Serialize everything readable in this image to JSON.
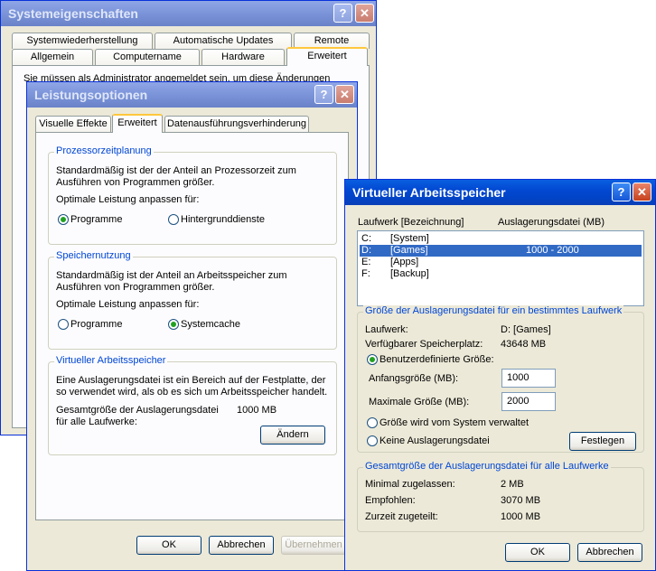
{
  "sysprops": {
    "title": "Systemeigenschaften",
    "tabs_row1": [
      "Systemwiederherstellung",
      "Automatische Updates",
      "Remote"
    ],
    "tabs_row2": [
      "Allgemein",
      "Computername",
      "Hardware",
      "Erweitert"
    ],
    "admin_text": "Sie müssen als Administrator angemeldet sein, um diese Änderungen"
  },
  "perf": {
    "title": "Leistungsoptionen",
    "tabs": [
      "Visuelle Effekte",
      "Erweitert",
      "Datenausführungsverhinderung"
    ],
    "cpu": {
      "title": "Prozessorzeitplanung",
      "desc1": "Standardmäßig ist der der Anteil an Prozessorzeit zum",
      "desc2": "Ausführen von Programmen größer.",
      "adjust": "Optimale Leistung anpassen für:",
      "opt1": "Programme",
      "opt2": "Hintergrunddienste"
    },
    "mem": {
      "title": "Speichernutzung",
      "desc1": "Standardmäßig ist der Anteil an Arbeitsspeicher zum",
      "desc2": "Ausführen von Programmen größer.",
      "adjust": "Optimale Leistung anpassen für:",
      "opt1": "Programme",
      "opt2": "Systemcache"
    },
    "vm": {
      "title": "Virtueller Arbeitsspeicher",
      "desc1": "Eine Auslagerungsdatei ist ein Bereich auf der Festplatte, der",
      "desc2": "so verwendet wird, als ob es sich um Arbeitsspeicher handelt.",
      "total1": "Gesamtgröße der Auslagerungsdatei",
      "total2": "für alle Laufwerke:",
      "total_value": "1000 MB",
      "change_label": "Ändern"
    },
    "ok": "OK",
    "cancel": "Abbrechen",
    "apply": "Übernehmen"
  },
  "vmem": {
    "title": "Virtueller Arbeitsspeicher",
    "col_drive": "Laufwerk [Bezeichnung]",
    "col_file": "Auslagerungsdatei (MB)",
    "drives": [
      {
        "letter": "C:",
        "label": "[System]",
        "size": ""
      },
      {
        "letter": "D:",
        "label": "[Games]",
        "size": "1000 - 2000"
      },
      {
        "letter": "E:",
        "label": "[Apps]",
        "size": ""
      },
      {
        "letter": "F:",
        "label": "[Backup]",
        "size": ""
      }
    ],
    "size_group": {
      "title": "Größe der Auslagerungsdatei für ein bestimmtes Laufwerk",
      "drive_label": "Laufwerk:",
      "drive_value": "D:  [Games]",
      "free_label": "Verfügbarer Speicherplatz:",
      "free_value": "43648 MB",
      "custom": "Benutzerdefinierte Größe:",
      "initial_label": "Anfangsgröße (MB):",
      "initial_value": "1000",
      "max_label": "Maximale Größe (MB):",
      "max_value": "2000",
      "system": "Größe wird vom System verwaltet",
      "none": "Keine Auslagerungsdatei",
      "set_label": "Festlegen"
    },
    "total_group": {
      "title": "Gesamtgröße der Auslagerungsdatei für alle Laufwerke",
      "min_label": "Minimal zugelassen:",
      "min_value": "2 MB",
      "rec_label": "Empfohlen:",
      "rec_value": "3070 MB",
      "cur_label": "Zurzeit zugeteilt:",
      "cur_value": "1000 MB"
    },
    "ok": "OK",
    "cancel": "Abbrechen"
  }
}
